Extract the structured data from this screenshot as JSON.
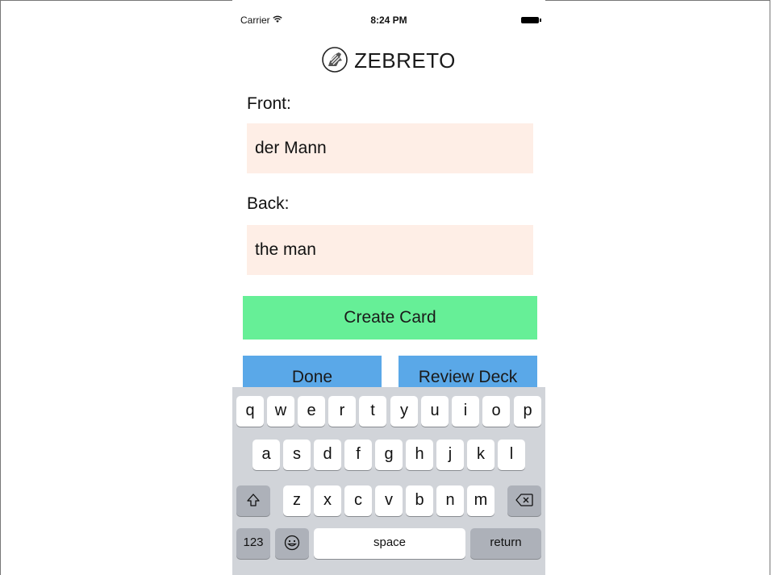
{
  "status_bar": {
    "carrier": "Carrier",
    "time": "8:24 PM"
  },
  "app": {
    "title": "ZEBRETO"
  },
  "form": {
    "front_label": "Front:",
    "front_value": "der Mann",
    "back_label": "Back:",
    "back_value": "the man"
  },
  "buttons": {
    "create": "Create Card",
    "done": "Done",
    "review": "Review Deck"
  },
  "keyboard": {
    "row1": [
      "q",
      "w",
      "e",
      "r",
      "t",
      "y",
      "u",
      "i",
      "o",
      "p"
    ],
    "row2": [
      "a",
      "s",
      "d",
      "f",
      "g",
      "h",
      "j",
      "k",
      "l"
    ],
    "row3": [
      "z",
      "x",
      "c",
      "v",
      "b",
      "n",
      "m"
    ],
    "numbers": "123",
    "space": "space",
    "return": "return",
    "shift_icon": "shift-icon",
    "delete_icon": "delete-icon",
    "emoji_icon": "emoji-icon"
  },
  "colors": {
    "field_bg": "#feeee6",
    "create_bg": "#66ef97",
    "nav_bg": "#5aa8e8",
    "keyboard_bg": "#d1d4d9"
  }
}
